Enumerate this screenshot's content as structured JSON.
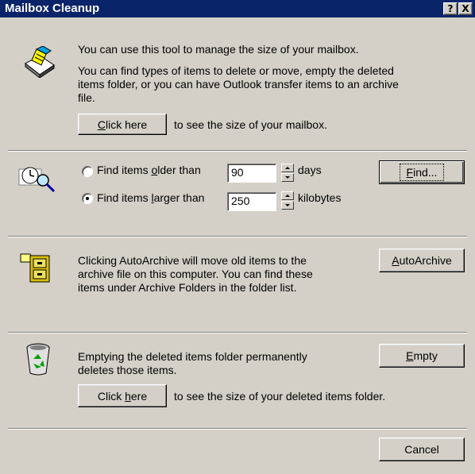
{
  "window": {
    "title": "Mailbox Cleanup",
    "help_glyph": "?",
    "close_glyph": "X"
  },
  "intro": {
    "line1": "You can use this tool to manage the size of your mailbox.",
    "line2": "You can find types of items to delete or move, empty the deleted",
    "line3": "items folder, or you can have Outlook transfer items to an archive",
    "line4": "file.",
    "size_button": {
      "pre": "",
      "ul": "C",
      "post": "lick here"
    },
    "size_caption": "to see the size of your mailbox."
  },
  "find": {
    "older_pre": "Find items ",
    "older_ul": "o",
    "older_post": "lder than",
    "older_value": "90",
    "older_unit": "days",
    "older_selected": false,
    "larger_pre": "Find items ",
    "larger_ul": "l",
    "larger_post": "arger than",
    "larger_value": "250",
    "larger_unit": "kilobytes",
    "larger_selected": true,
    "find_button": {
      "ul": "F",
      "post": "ind..."
    }
  },
  "archive": {
    "line1": "Clicking AutoArchive will move old items to the",
    "line2": "archive file on this computer.  You can find these",
    "line3": "items under Archive Folders in the folder list.",
    "button": {
      "ul": "A",
      "post": "utoArchive"
    }
  },
  "deleted": {
    "line1": "Emptying the deleted items folder permanently",
    "line2": "deletes those items.",
    "empty_button": {
      "ul": "E",
      "post": "mpty"
    },
    "size_button": {
      "pre": "Click ",
      "ul": "h",
      "post": "ere"
    },
    "size_caption": "to see the size of your deleted items folder."
  },
  "footer": {
    "cancel_label": "Cancel"
  },
  "colors": {
    "title_bar": "#0a246a",
    "face": "#d4d0c8"
  }
}
